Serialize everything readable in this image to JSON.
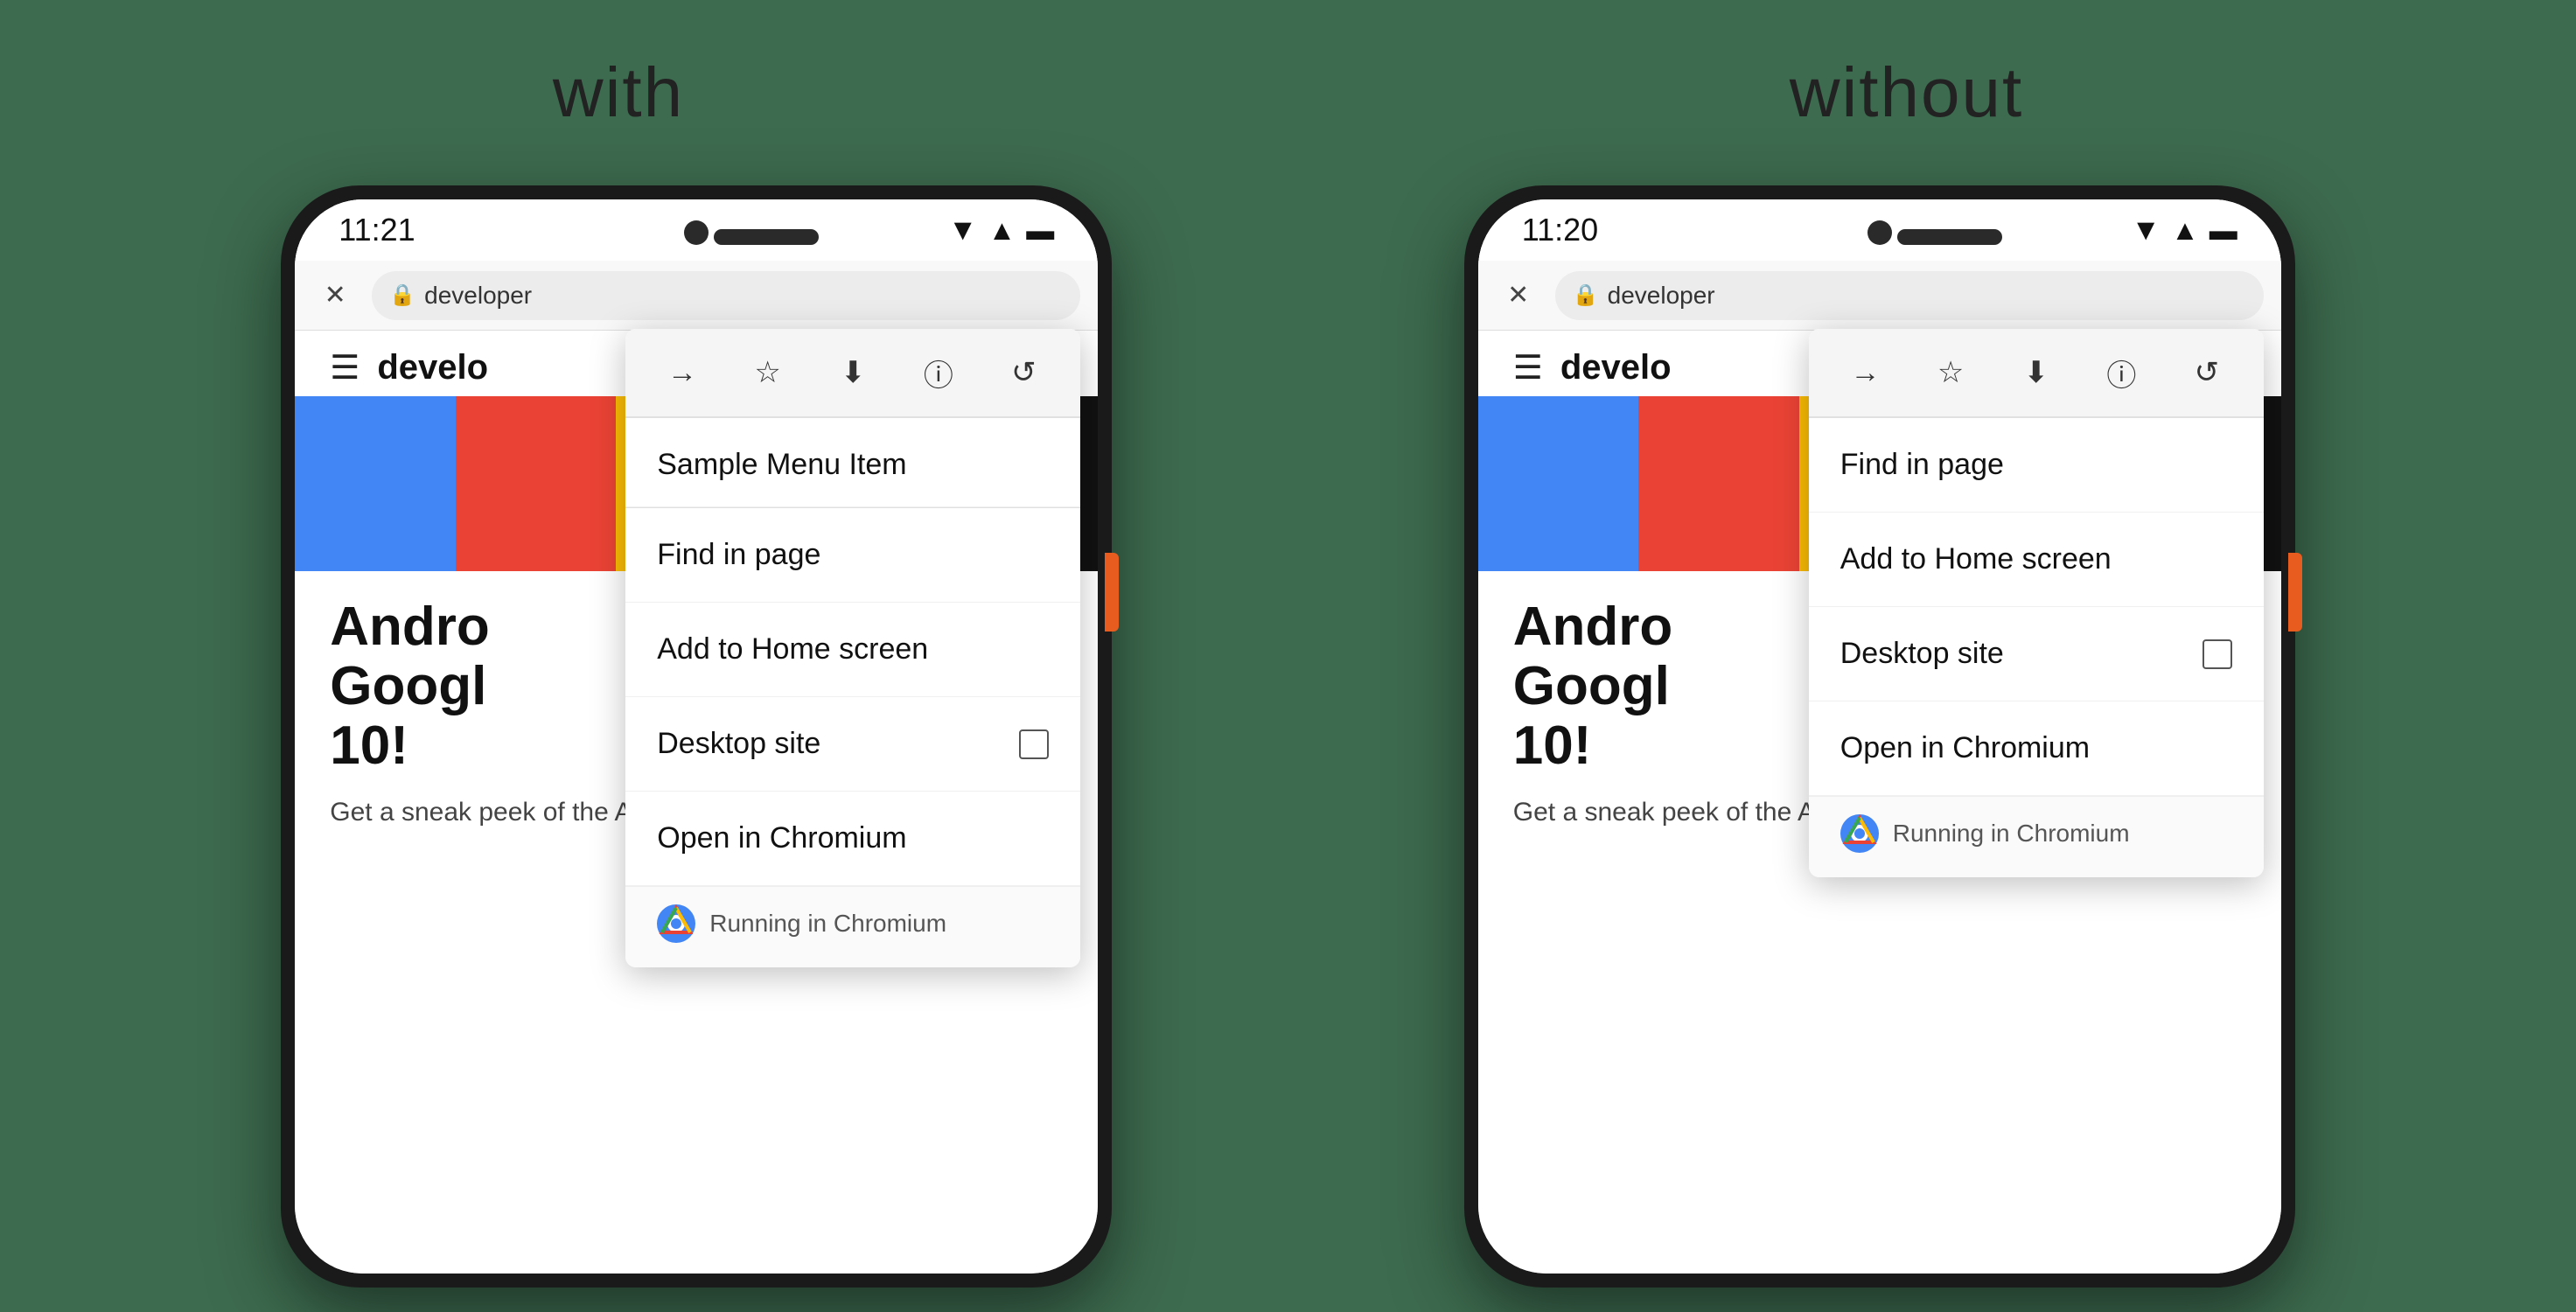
{
  "background_color": "#3d6b4f",
  "labels": {
    "with": "with",
    "without": "without"
  },
  "phone_left": {
    "time": "11:21",
    "address": "developer",
    "page_title_line1": "Andro",
    "page_title_line2": "Googl",
    "page_title_line3": "10!",
    "page_subtitle": "Get a sneak peek of the Android talks that",
    "page_domain": "develo",
    "dropdown": {
      "icons": [
        "→",
        "☆",
        "⬇",
        "ⓘ",
        "↺"
      ],
      "items": [
        {
          "label": "Sample Menu Item",
          "special": true
        },
        {
          "label": "Find in page"
        },
        {
          "label": "Add to Home screen"
        },
        {
          "label": "Desktop site",
          "has_checkbox": true
        },
        {
          "label": "Open in Chromium"
        }
      ],
      "footer": "Running in Chromium"
    }
  },
  "phone_right": {
    "time": "11:20",
    "address": "developer",
    "page_title_line1": "Andro",
    "page_title_line2": "Googl",
    "page_title_line3": "10!",
    "page_subtitle": "Get a sneak peek of the Android talks that",
    "page_domain": "develo",
    "dropdown": {
      "icons": [
        "→",
        "☆",
        "⬇",
        "ⓘ",
        "↺"
      ],
      "items": [
        {
          "label": "Find in page"
        },
        {
          "label": "Add to Home screen"
        },
        {
          "label": "Desktop site",
          "has_checkbox": true
        },
        {
          "label": "Open in Chromium"
        }
      ],
      "footer": "Running in Chromium"
    }
  },
  "color_bars": [
    "#4285F4",
    "#EA4335",
    "#FBBC04",
    "#34A853",
    "#111111",
    "#1a73e8"
  ]
}
